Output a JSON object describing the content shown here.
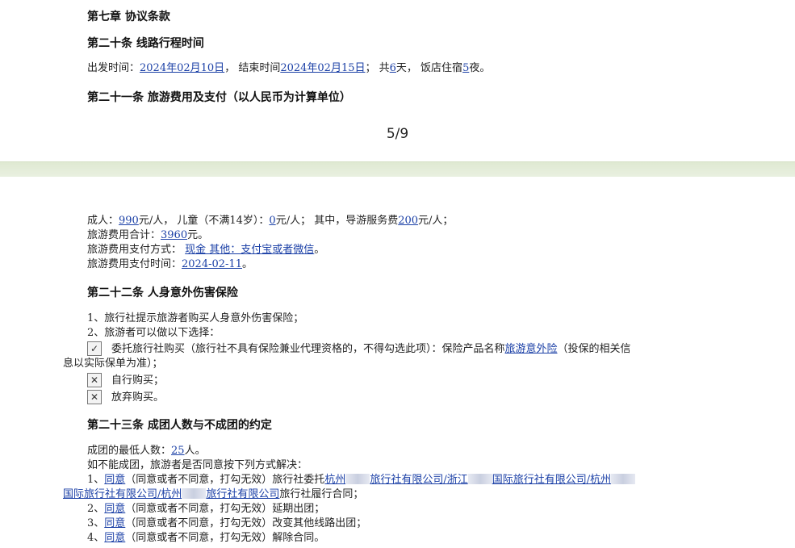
{
  "chapter7": {
    "title": "第七章 协议条款"
  },
  "art20": {
    "title": "第二十条 线路行程时间",
    "depart_label": "出发时间：",
    "depart_date": "2024年02月10日",
    "sep1": "，  结束时间",
    "end_date": "2024年02月15日",
    "sep2": "；  共",
    "days": "6",
    "sep3": "天，  饭店住宿",
    "nights": "5",
    "sep4": "夜。"
  },
  "art21": {
    "title": "第二十一条 旅游费用及支付（以人民币为计算单位）"
  },
  "page_indicator": "5/9",
  "fees": {
    "adult_label": "成人：",
    "adult_price": "990",
    "adult_unit": "元/人，  儿童（不满14岁）：",
    "child_price": "0",
    "child_unit": "元/人；  其中，导游服务费",
    "guide_fee": "200",
    "guide_unit": "元/人；",
    "total_label": "旅游费用合计：",
    "total": "3960",
    "total_unit": "元。",
    "method_label": "旅游费用支付方式：  ",
    "method": "现金 其他：支付宝或者微信",
    "method_end": "。",
    "time_label": "旅游费用支付时间：",
    "time": "2024-02-11",
    "time_end": "。"
  },
  "art22": {
    "title": "第二十二条 人身意外伤害保险",
    "item1": "1、旅行社提示旅游者购买人身意外伤害保险；",
    "item2": "2、旅游者可以做以下选择：",
    "option1_mark": "✓",
    "option1_text": "委托旅行社购买（旅行社不具有保险兼业代理资格的，不得勾选此项）：保险产品名称",
    "option1_product": "旅游意外险",
    "option1_tail": "（投保的相关信",
    "option1_wrap": "息以实际保单为准）；",
    "option2_mark": "✕",
    "option2_text": "自行购买；",
    "option3_mark": "✕",
    "option3_text": "放弃购买。"
  },
  "art23": {
    "title": "第二十三条 成团人数与不成团的约定",
    "min_label": "成团的最低人数：",
    "min_count": "25",
    "min_unit": "人。",
    "ifnot": "如不能成团，旅游者是否同意按下列方式解决：",
    "opt1_prefix": "1、",
    "agree": "同意",
    "opt1_mid": "（同意或者不同意，打勾无效）旅行社委托",
    "agency_a1": "杭州",
    "agency_a2": "旅行社有限公司/浙江",
    "agency_a3": "国际旅行社有限公司/杭州",
    "agency_b1": "国际旅行社有限公司/杭州",
    "agency_b2": "旅行社有限公司",
    "opt1_end": "旅行社履行合同；",
    "opt2_prefix": "2、",
    "opt2_text": "（同意或者不同意，打勾无效）延期出团；",
    "opt3_prefix": "3、",
    "opt3_text": "（同意或者不同意，打勾无效）改变其他线路出团；",
    "opt4_prefix": "4、",
    "opt4_text": "（同意或者不同意，打勾无效）解除合同。"
  }
}
